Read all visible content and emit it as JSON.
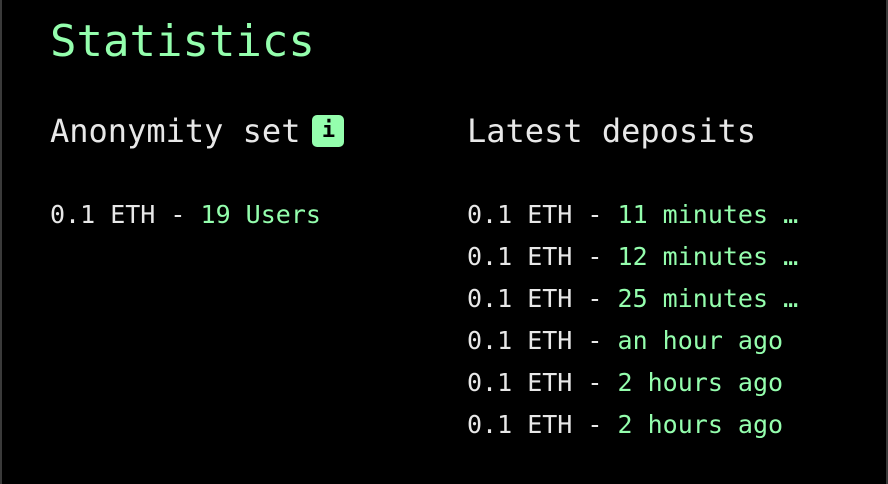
{
  "title": "Statistics",
  "anonymity": {
    "heading": "Anonymity set",
    "info_icon": "info-icon",
    "info_glyph": "i",
    "rows": [
      {
        "amount": "0.1 ETH",
        "sep": " - ",
        "value": "19 Users"
      }
    ]
  },
  "deposits": {
    "heading": "Latest deposits",
    "rows": [
      {
        "amount": "0.1 ETH",
        "sep": " - ",
        "value": "11 minutes …"
      },
      {
        "amount": "0.1 ETH",
        "sep": " - ",
        "value": "12 minutes …"
      },
      {
        "amount": "0.1 ETH",
        "sep": " - ",
        "value": "25 minutes …"
      },
      {
        "amount": "0.1 ETH",
        "sep": " - ",
        "value": "an hour ago"
      },
      {
        "amount": "0.1 ETH",
        "sep": " - ",
        "value": "2 hours ago"
      },
      {
        "amount": "0.1 ETH",
        "sep": " - ",
        "value": "2 hours ago"
      }
    ]
  },
  "colors": {
    "accent": "#94fead",
    "background": "#000000",
    "text": "#e8e8e8"
  }
}
